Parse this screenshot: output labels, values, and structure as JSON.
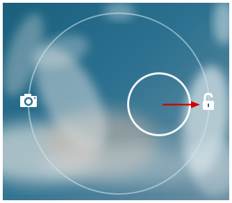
{
  "lockscreen": {
    "background_colors": {
      "deep_blue": "#185f7e",
      "mid_blue": "#2f7593",
      "cloud_white": "#d9e2e5",
      "cloud_warm": "#b8a89e"
    },
    "targets": {
      "camera_icon": "camera-icon",
      "unlock_icon": "unlock-icon"
    },
    "indicator_colors": {
      "ring": "#d6e7ef",
      "handle": "#ffffff",
      "arrow": "#d00000"
    }
  }
}
